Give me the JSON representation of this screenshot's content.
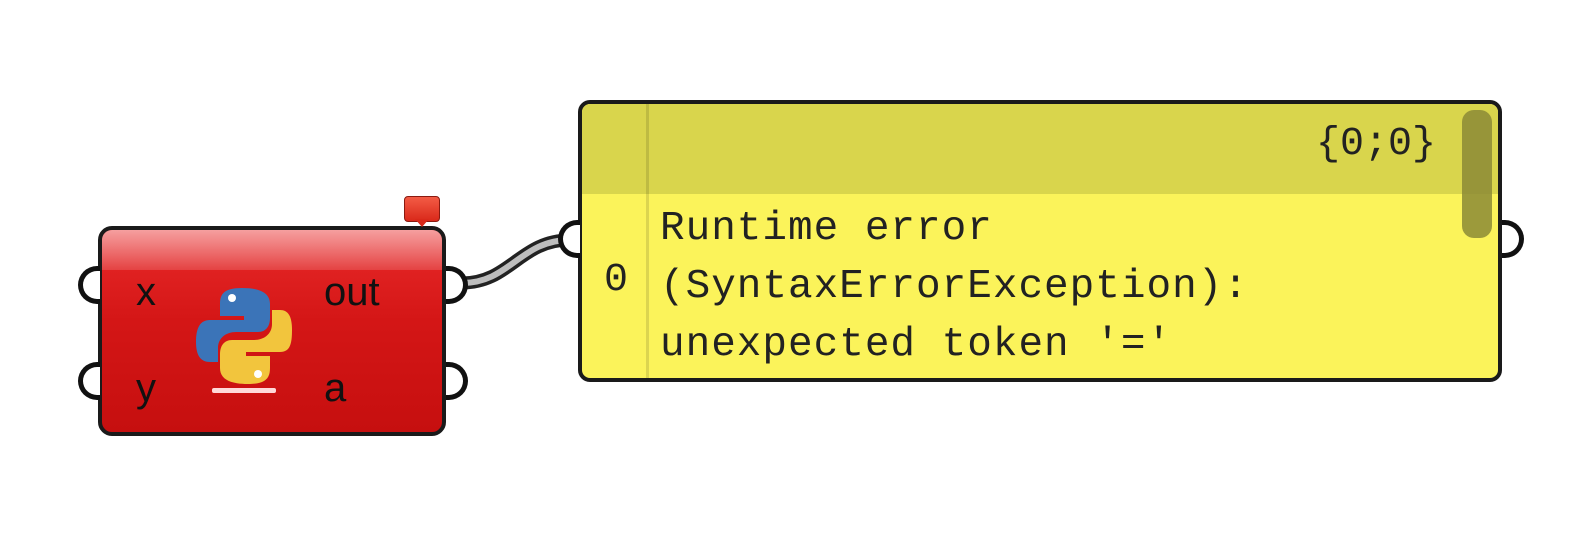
{
  "python_component": {
    "inputs": [
      {
        "name": "x"
      },
      {
        "name": "y"
      }
    ],
    "outputs": [
      {
        "name": "out"
      },
      {
        "name": "a"
      }
    ],
    "icon": "python-icon",
    "state": "error",
    "colors": {
      "body": "#d41616",
      "balloon": "#e8412e"
    }
  },
  "panel": {
    "path": "{0;0}",
    "rows": [
      {
        "index": "0",
        "lines": [
          "Runtime error",
          "(SyntaxErrorException):",
          "unexpected token '='"
        ]
      }
    ],
    "colors": {
      "background": "#fbf35a",
      "header": "#d9d54c"
    }
  }
}
